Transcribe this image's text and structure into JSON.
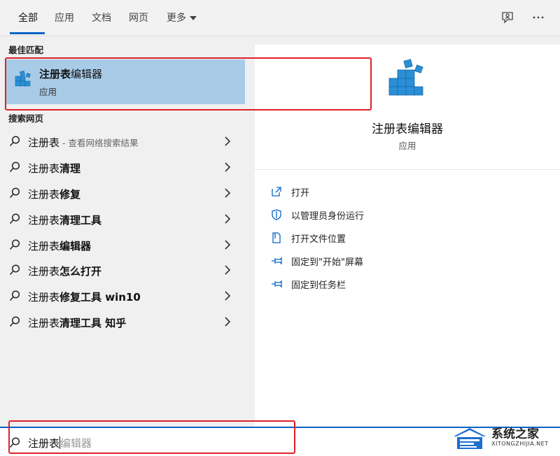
{
  "tabs": [
    {
      "label": "全部",
      "active": true
    },
    {
      "label": "应用",
      "active": false
    },
    {
      "label": "文档",
      "active": false
    },
    {
      "label": "网页",
      "active": false
    },
    {
      "label": "更多",
      "active": false
    }
  ],
  "top_icons": [
    "feedback-icon",
    "more-options-icon"
  ],
  "best_match": {
    "section_title": "最佳匹配",
    "name_bold": "注册表",
    "name_rest": "编辑器",
    "type": "应用"
  },
  "web_search": {
    "section_title": "搜索网页",
    "items": [
      {
        "prefix": "注册表",
        "bold": "",
        "hint": "- 查看网络搜索结果"
      },
      {
        "prefix": "注册表",
        "bold": "清理",
        "hint": ""
      },
      {
        "prefix": "注册表",
        "bold": "修复",
        "hint": ""
      },
      {
        "prefix": "注册表",
        "bold": "清理工具",
        "hint": ""
      },
      {
        "prefix": "注册表",
        "bold": "编辑器",
        "hint": ""
      },
      {
        "prefix": "注册表",
        "bold": "怎么打开",
        "hint": ""
      },
      {
        "prefix": "注册表",
        "bold": "修复工具 win10",
        "hint": ""
      },
      {
        "prefix": "注册表",
        "bold": "清理工具 知乎",
        "hint": ""
      }
    ]
  },
  "detail": {
    "app_name": "注册表编辑器",
    "app_type": "应用",
    "actions": [
      {
        "label": "打开",
        "icon": "open-icon"
      },
      {
        "label": "以管理员身份运行",
        "icon": "shield-icon"
      },
      {
        "label": "打开文件位置",
        "icon": "file-location-icon"
      },
      {
        "label": "固定到\"开始\"屏幕",
        "icon": "pin-icon"
      },
      {
        "label": "固定到任务栏",
        "icon": "pin-icon"
      }
    ]
  },
  "search": {
    "typed": "注册表",
    "ghost": "编辑器"
  },
  "watermark": {
    "title": "系统之家",
    "url": "XITONGZHIJIA.NET"
  },
  "colors": {
    "accent": "#0a64c8",
    "highlight": "#a8cbe8",
    "annotation": "#e0202a"
  }
}
